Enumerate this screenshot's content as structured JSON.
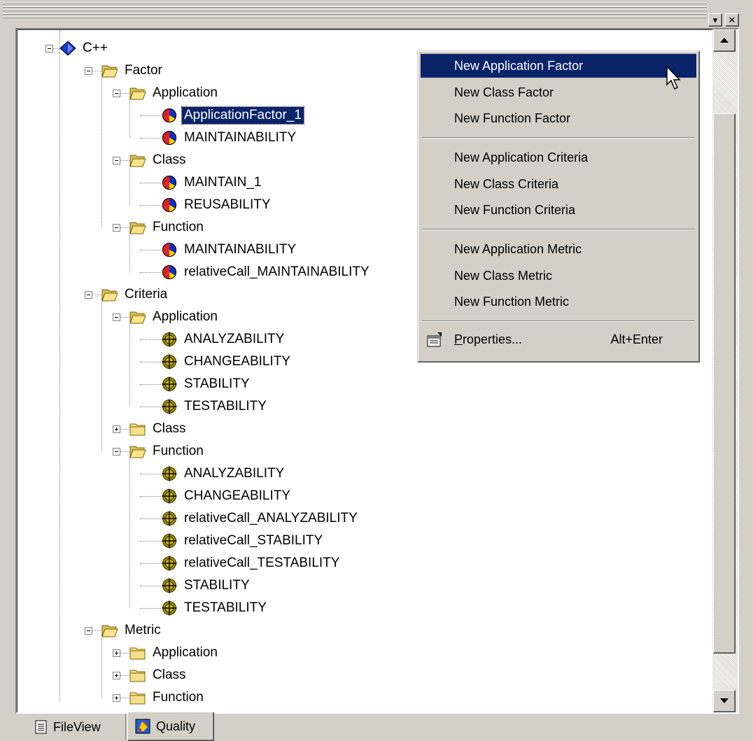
{
  "titlebar": {
    "restore_glyph": "▾",
    "close_glyph": "✕",
    "restore_icon": "restore-icon",
    "close_icon": "close-icon"
  },
  "tree": {
    "root": "C++",
    "factor": {
      "label": "Factor",
      "application": {
        "label": "Application",
        "items": [
          "ApplicationFactor_1",
          "MAINTAINABILITY"
        ],
        "selected": "ApplicationFactor_1"
      },
      "class": {
        "label": "Class",
        "items": [
          "MAINTAIN_1",
          "REUSABILITY"
        ]
      },
      "function": {
        "label": "Function",
        "items": [
          "MAINTAINABILITY",
          "relativeCall_MAINTAINABILITY"
        ]
      }
    },
    "criteria": {
      "label": "Criteria",
      "application": {
        "label": "Application",
        "items": [
          "ANALYZABILITY",
          "CHANGEABILITY",
          "STABILITY",
          "TESTABILITY"
        ]
      },
      "class": {
        "label": "Class"
      },
      "function": {
        "label": "Function",
        "items": [
          "ANALYZABILITY",
          "CHANGEABILITY",
          "relativeCall_ANALYZABILITY",
          "relativeCall_STABILITY",
          "relativeCall_TESTABILITY",
          "STABILITY",
          "TESTABILITY"
        ]
      }
    },
    "metric": {
      "label": "Metric",
      "application": {
        "label": "Application"
      },
      "class": {
        "label": "Class"
      },
      "function": {
        "label": "Function"
      }
    }
  },
  "context_menu": {
    "groups": [
      [
        "New Application Factor",
        "New Class Factor",
        "New Function Factor"
      ],
      [
        "New Application Criteria",
        "New Class Criteria",
        "New Function Criteria"
      ],
      [
        "New Application Metric",
        "New Class Metric",
        "New Function Metric"
      ]
    ],
    "highlighted": "New Application Factor",
    "properties": {
      "label": "Properties...",
      "shortcut": "Alt+Enter",
      "icon": "properties-icon"
    }
  },
  "tabs": [
    {
      "label": "FileView",
      "icon": "document-icon",
      "active": false
    },
    {
      "label": "Quality",
      "icon": "quality-icon",
      "active": true
    }
  ],
  "colors": {
    "highlight": "#0a246a",
    "face": "#d4d0c8",
    "folder": "#f0dc7a",
    "factor_red": "#e02020",
    "factor_blue": "#1030c0",
    "factor_yellow": "#ffd800",
    "criteria_olive": "#8a7a00"
  }
}
